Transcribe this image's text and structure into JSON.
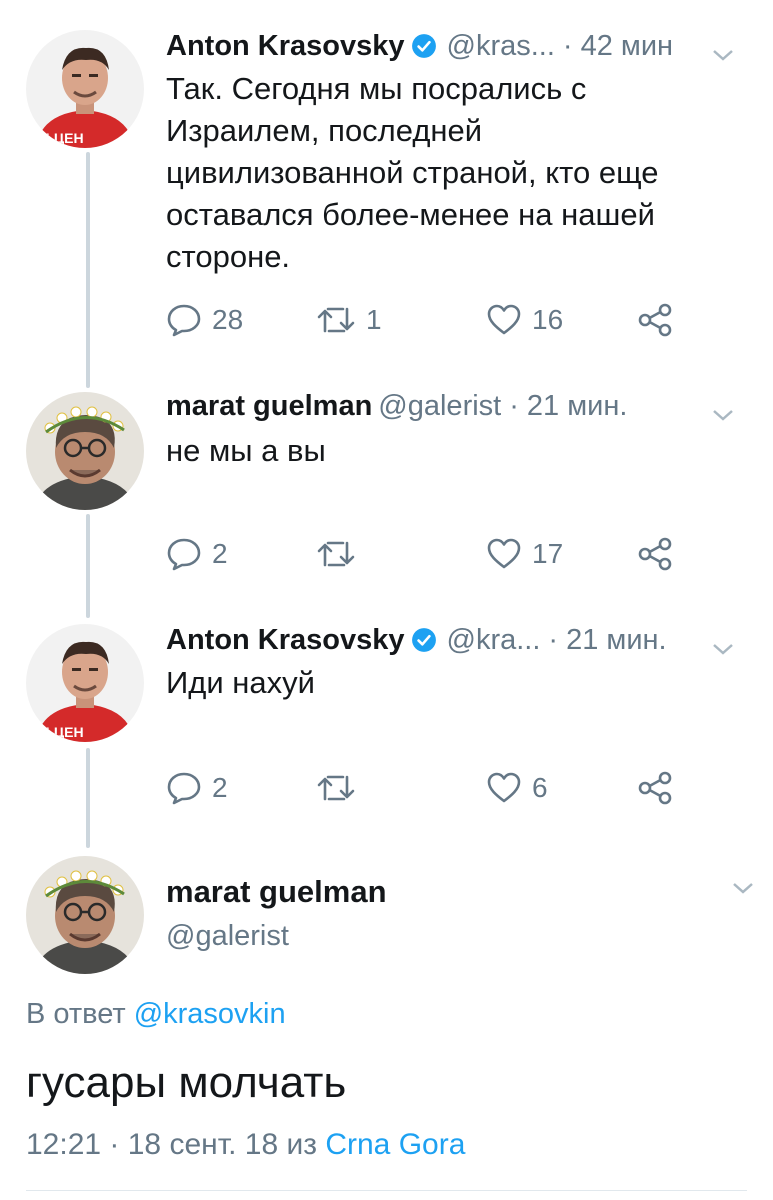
{
  "tweets": [
    {
      "name": "Anton Krasovsky",
      "verified": true,
      "handle": "@kras...",
      "separator": "·",
      "time": "42 мин",
      "text": "Так. Сегодня мы посрались с Израилем, последней цивилизованной страной, кто еще оставался более-менее на нашей стороне.",
      "replies": "28",
      "retweets": "1",
      "likes": "16",
      "avatar_text": "ИД.ЦЕН"
    },
    {
      "name": "marat guelman",
      "verified": false,
      "handle": "@galerist",
      "separator": "·",
      "time": "21 мин.",
      "text": "не мы а вы",
      "replies": "2",
      "retweets": "",
      "likes": "17"
    },
    {
      "name": "Anton Krasovsky",
      "verified": true,
      "handle": "@kra...",
      "separator": "·",
      "time": "21 мин.",
      "text": "Иди нахуй",
      "replies": "2",
      "retweets": "",
      "likes": "6",
      "avatar_text": "ИД.ЦЕН"
    }
  ],
  "main_tweet": {
    "name": "marat guelman",
    "handle": "@galerist",
    "reply_prefix": "В ответ",
    "reply_to": "@krasovkin",
    "text": "гусары молчать",
    "timestamp": "12:21 · 18 сент. 18 из",
    "source": "Crna Gora"
  },
  "icons": {
    "reply": "reply-icon",
    "retweet": "retweet-icon",
    "like": "like-icon",
    "share": "share-icon",
    "verified": "verified-badge-icon",
    "menu": "chevron-down-icon"
  },
  "colors": {
    "accent": "#1da1f2",
    "secondary_text": "#657786",
    "thread_line": "#ccd6dd"
  }
}
